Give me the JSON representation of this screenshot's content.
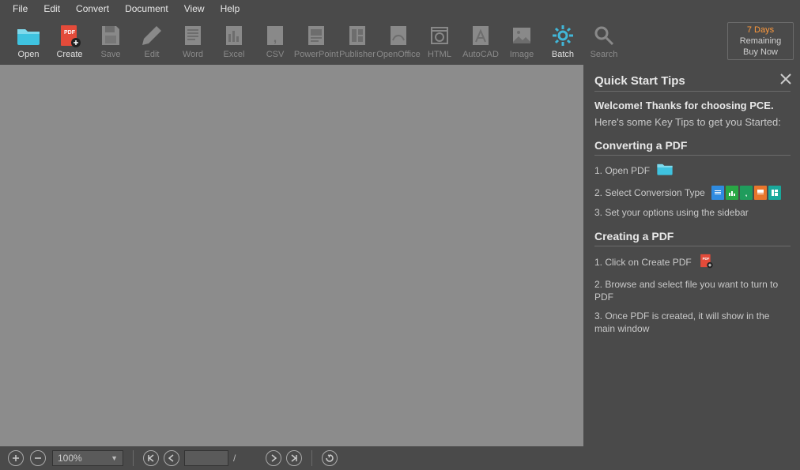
{
  "menubar": [
    "File",
    "Edit",
    "Convert",
    "Document",
    "View",
    "Help"
  ],
  "toolbar": [
    {
      "key": "open",
      "label": "Open",
      "enabled": true
    },
    {
      "key": "create",
      "label": "Create",
      "enabled": true
    },
    {
      "key": "save",
      "label": "Save",
      "enabled": false
    },
    {
      "key": "edit",
      "label": "Edit",
      "enabled": false
    },
    {
      "key": "word",
      "label": "Word",
      "enabled": false
    },
    {
      "key": "excel",
      "label": "Excel",
      "enabled": false
    },
    {
      "key": "csv",
      "label": "CSV",
      "enabled": false
    },
    {
      "key": "powerpoint",
      "label": "PowerPoint",
      "enabled": false
    },
    {
      "key": "publisher",
      "label": "Publisher",
      "enabled": false
    },
    {
      "key": "openoffice",
      "label": "OpenOffice",
      "enabled": false
    },
    {
      "key": "html",
      "label": "HTML",
      "enabled": false
    },
    {
      "key": "autocad",
      "label": "AutoCAD",
      "enabled": false
    },
    {
      "key": "image",
      "label": "Image",
      "enabled": false
    },
    {
      "key": "batch",
      "label": "Batch",
      "enabled": true
    },
    {
      "key": "search",
      "label": "Search",
      "enabled": false
    }
  ],
  "trial": {
    "days": "7 Days",
    "remaining": "Remaining",
    "buy": "Buy Now"
  },
  "tips": {
    "title": "Quick Start Tips",
    "welcome": "Welcome! Thanks for choosing PCE.",
    "sub": "Here's some Key Tips to get you Started:",
    "section1": {
      "title": "Converting a PDF",
      "steps": [
        "1. Open PDF",
        "2. Select Conversion Type",
        "3. Set your options using the sidebar"
      ]
    },
    "section2": {
      "title": "Creating a PDF",
      "steps": [
        "1. Click on Create PDF",
        "2. Browse and select file you want to turn to PDF",
        "3. Once PDF is created, it will show in the main window"
      ]
    }
  },
  "statusbar": {
    "zoom": "100%",
    "page_sep": "/"
  },
  "colors": {
    "folder": "#3fc3e0",
    "pdf": "#e44b3a",
    "gear": "#41b7d8",
    "word": "#2f8be0",
    "excel": "#29a745",
    "csv": "#1f9c5c",
    "ppt": "#e8762c",
    "pub": "#1aa89b"
  }
}
